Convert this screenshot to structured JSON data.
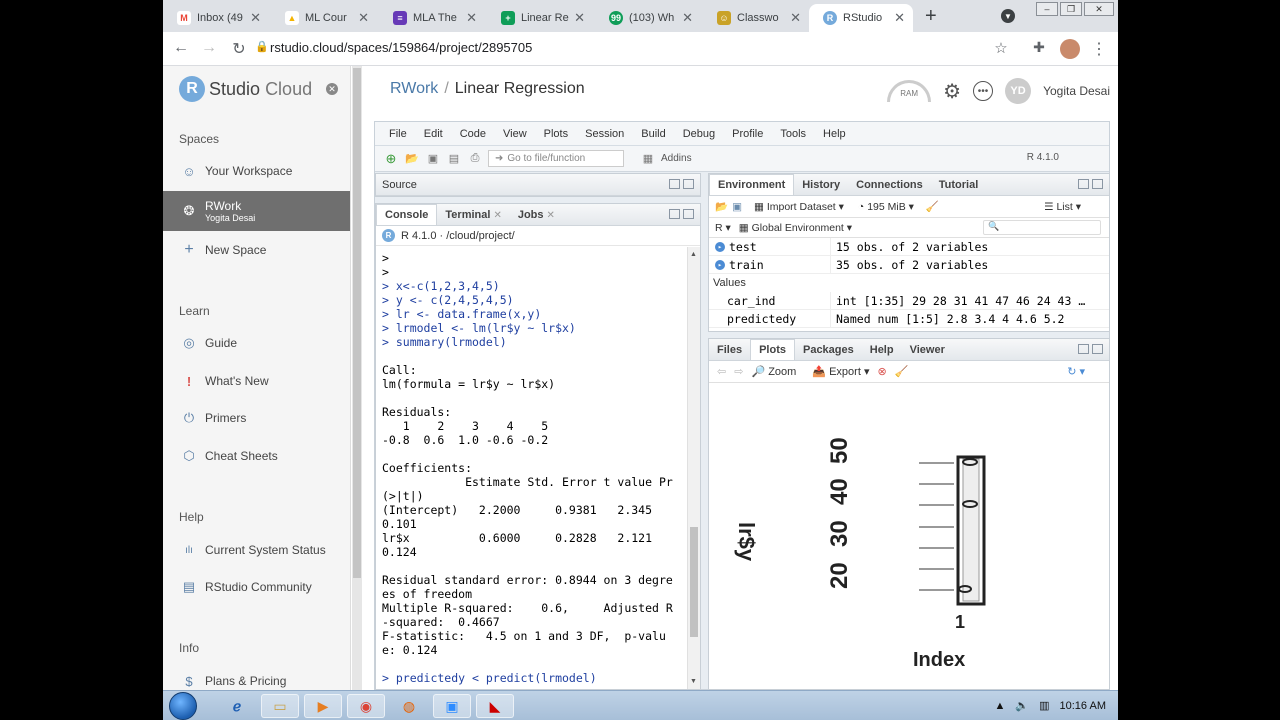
{
  "browser": {
    "tabs": [
      {
        "label": "Inbox (49",
        "icon": "gmail-icon",
        "color": "#ea4335",
        "glyph": "M"
      },
      {
        "label": "ML Cour",
        "icon": "drive-icon",
        "color": "#f4b400",
        "glyph": "▲"
      },
      {
        "label": "MLA The",
        "icon": "forms-icon",
        "color": "#673ab7",
        "glyph": "≡"
      },
      {
        "label": "Linear Re",
        "icon": "sheets-icon",
        "color": "#0f9d58",
        "glyph": "+"
      },
      {
        "label": "(103) Wh",
        "icon": "youtube-icon",
        "color": "#0f9d58",
        "glyph": "99"
      },
      {
        "label": "Classwo",
        "icon": "classroom-icon",
        "color": "#c9a227",
        "glyph": "☺"
      },
      {
        "label": "RStudio",
        "icon": "rstudio-icon",
        "color": "#75aadb",
        "glyph": "R"
      }
    ],
    "new_tab": "+",
    "url": "rstudio.cloud/spaces/159864/project/2895705"
  },
  "sidebar": {
    "logo_r": "R",
    "logo_studio": "Studio",
    "logo_cloud": "Cloud",
    "sections": {
      "spaces": "Spaces",
      "learn": "Learn",
      "help": "Help",
      "info": "Info"
    },
    "spaces_items": [
      {
        "label": "Your Workspace",
        "icon": "person-icon",
        "glyph": "☺"
      },
      {
        "label": "RWork",
        "sub": "Yogita Desai",
        "icon": "space-icon",
        "glyph": "❂"
      },
      {
        "label": "New Space",
        "icon": "plus-icon",
        "glyph": "+"
      }
    ],
    "learn_items": [
      {
        "label": "Guide",
        "icon": "compass-icon",
        "glyph": "◎"
      },
      {
        "label": "What's New",
        "icon": "exclamation-icon",
        "glyph": "!"
      },
      {
        "label": "Primers",
        "icon": "power-icon",
        "glyph": "⏻"
      },
      {
        "label": "Cheat Sheets",
        "icon": "hexagon-icon",
        "glyph": "⬡"
      }
    ],
    "help_items": [
      {
        "label": "Current System Status",
        "icon": "pulse-icon",
        "glyph": "ılı"
      },
      {
        "label": "RStudio Community",
        "icon": "chat-icon",
        "glyph": "▤"
      }
    ],
    "info_items": [
      {
        "label": "Plans & Pricing",
        "icon": "dollar-icon",
        "glyph": "$"
      }
    ]
  },
  "header": {
    "space_link": "RWork",
    "slash": "/",
    "project_title": "Linear Regression",
    "ram_label": "RAM",
    "user_initials": "YD",
    "user_name": "Yogita Desai"
  },
  "ide": {
    "menu": [
      "File",
      "Edit",
      "Code",
      "View",
      "Plots",
      "Session",
      "Build",
      "Debug",
      "Profile",
      "Tools",
      "Help"
    ],
    "goto_placeholder": "Go to file/function",
    "addins": "Addins",
    "r_version": "R 4.1.0",
    "source_tab": "Source",
    "console_tabs": [
      "Console",
      "Terminal",
      "Jobs"
    ],
    "console_path": "R 4.1.0 · /cloud/project/",
    "console_lines": [
      {
        "t": ">",
        "cmd": false
      },
      {
        "t": ">",
        "cmd": false
      },
      {
        "t": "> x<-c(1,2,3,4,5)",
        "cmd": true
      },
      {
        "t": "> y <- c(2,4,5,4,5)",
        "cmd": true
      },
      {
        "t": "> lr <- data.frame(x,y)",
        "cmd": true
      },
      {
        "t": "> lrmodel <- lm(lr$y ~ lr$x)",
        "cmd": true
      },
      {
        "t": "> summary(lrmodel)",
        "cmd": true
      },
      {
        "t": "",
        "cmd": false
      },
      {
        "t": "Call:",
        "cmd": false
      },
      {
        "t": "lm(formula = lr$y ~ lr$x)",
        "cmd": false
      },
      {
        "t": "",
        "cmd": false
      },
      {
        "t": "Residuals:",
        "cmd": false
      },
      {
        "t": "   1    2    3    4    5",
        "cmd": false
      },
      {
        "t": "-0.8  0.6  1.0 -0.6 -0.2",
        "cmd": false
      },
      {
        "t": "",
        "cmd": false
      },
      {
        "t": "Coefficients:",
        "cmd": false
      },
      {
        "t": "            Estimate Std. Error t value Pr",
        "cmd": false
      },
      {
        "t": "(>|t|)",
        "cmd": false
      },
      {
        "t": "(Intercept)   2.2000     0.9381   2.345",
        "cmd": false
      },
      {
        "t": "0.101",
        "cmd": false
      },
      {
        "t": "lr$x          0.6000     0.2828   2.121",
        "cmd": false
      },
      {
        "t": "0.124",
        "cmd": false
      },
      {
        "t": "",
        "cmd": false
      },
      {
        "t": "Residual standard error: 0.8944 on 3 degre",
        "cmd": false
      },
      {
        "t": "es of freedom",
        "cmd": false
      },
      {
        "t": "Multiple R-squared:    0.6,     Adjusted R",
        "cmd": false
      },
      {
        "t": "-squared:  0.4667",
        "cmd": false
      },
      {
        "t": "F-statistic:   4.5 on 1 and 3 DF,  p-valu",
        "cmd": false
      },
      {
        "t": "e: 0.124",
        "cmd": false
      },
      {
        "t": "",
        "cmd": false
      },
      {
        "t": "> predictedy < predict(lrmodel)",
        "cmd": true
      }
    ],
    "env_tabs": [
      "Environment",
      "History",
      "Connections",
      "Tutorial"
    ],
    "import_dataset": "Import Dataset",
    "memory": "195 MiB",
    "list_view": "List",
    "r_lang": "R",
    "global_env": "Global Environment",
    "data_rows": [
      {
        "name": "test",
        "value": "15 obs. of 2 variables"
      },
      {
        "name": "train",
        "value": "35 obs. of 2 variables"
      }
    ],
    "values_header": "Values",
    "value_rows": [
      {
        "name": "car_ind",
        "value": "int [1:35] 29 28 31 41 47 46 24 43 …"
      },
      {
        "name": "predictedy",
        "value": "Named num [1:5] 2.8 3.4 4 4.6 5.2"
      }
    ],
    "files_tabs": [
      "Files",
      "Plots",
      "Packages",
      "Help",
      "Viewer"
    ],
    "zoom": "Zoom",
    "export": "Export"
  },
  "plot": {
    "ylabel": "lr$y",
    "xlabel": "Index",
    "tick_x": "1",
    "ticks_y": [
      "20",
      "30",
      "40",
      "50"
    ]
  },
  "taskbar": {
    "time": "10:16 AM"
  }
}
